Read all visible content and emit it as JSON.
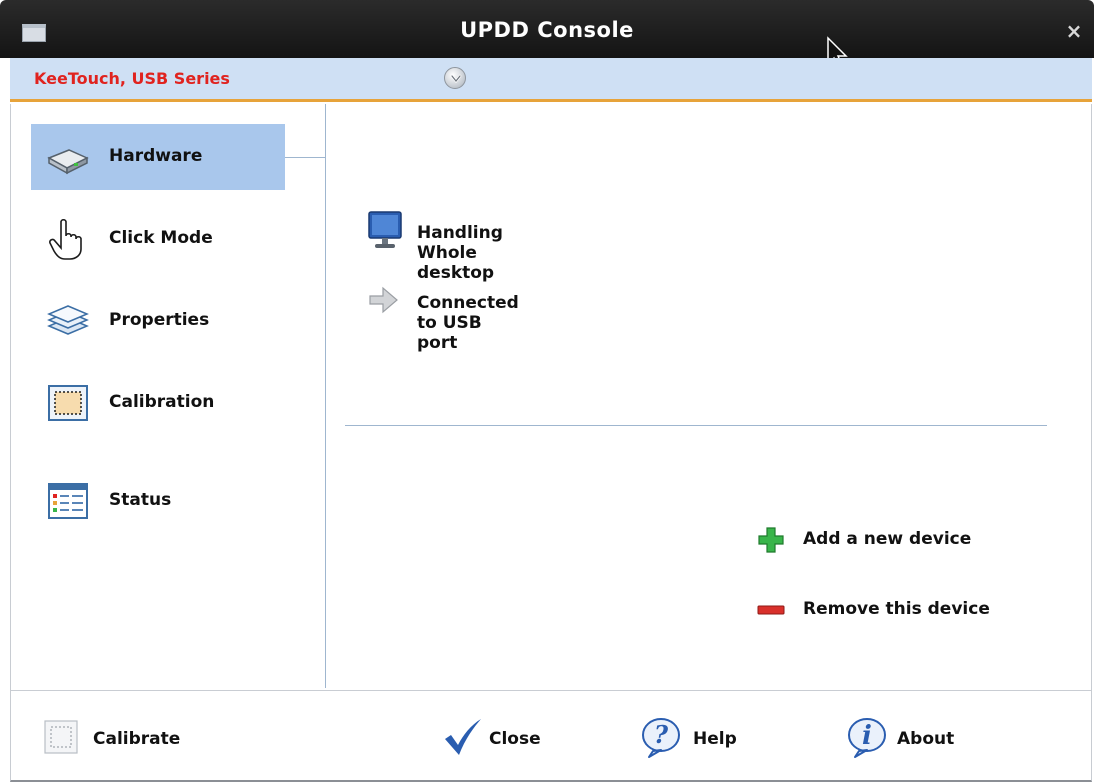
{
  "window": {
    "title": "UPDD Console",
    "window_icon": "window-menu-icon",
    "close_icon": "close-icon",
    "close_glyph": "×"
  },
  "device": {
    "name": "KeeTouch, USB Series",
    "name_color": "#e0231f",
    "selector_icon": "chevron-down-circle-icon"
  },
  "sidebar": {
    "items": [
      {
        "label": "Hardware",
        "icon": "hard-drive-icon",
        "selected": true
      },
      {
        "label": "Click Mode",
        "icon": "hand-pointer-icon",
        "selected": false
      },
      {
        "label": "Properties",
        "icon": "layers-icon",
        "selected": false
      },
      {
        "label": "Calibration",
        "icon": "calibration-frame-icon",
        "selected": false
      },
      {
        "label": "Status",
        "icon": "status-list-icon",
        "selected": false
      }
    ]
  },
  "hardware": {
    "handling_label": "Handling Whole desktop",
    "handling_icon": "monitor-icon",
    "connection_label": "Connected to USB port",
    "connection_icon": "arrow-right-icon",
    "add_device_label": "Add a new device",
    "add_device_icon": "plus-icon",
    "remove_device_label": "Remove this device",
    "remove_device_icon": "minus-icon"
  },
  "footer": {
    "calibrate_label": "Calibrate",
    "close_label": "Close",
    "help_label": "Help",
    "about_label": "About"
  },
  "colors": {
    "selection": "#a9c7ec",
    "device_bar": "#cfe0f4",
    "accent_orange": "#e7a33a",
    "add_green": "#39b54a",
    "remove_red": "#d9302b"
  }
}
